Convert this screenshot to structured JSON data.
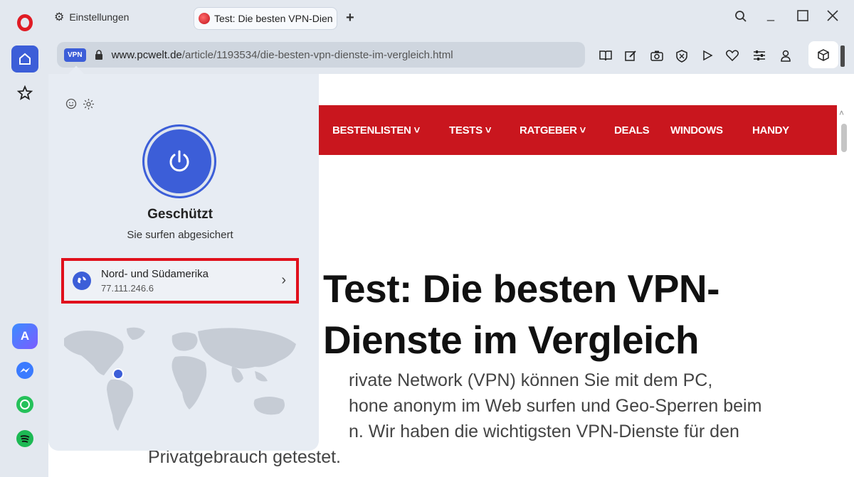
{
  "tabs": {
    "settings_label": "Einstellungen",
    "active_label": "Test: Die besten VPN-Dien"
  },
  "address": {
    "vpn_badge": "VPN",
    "url_domain": "www.pcwelt.de",
    "url_path": "/article/1193534/die-besten-vpn-dienste-im-vergleich.html"
  },
  "nav": {
    "items": [
      "BESTENLISTEN ˅",
      "TESTS ˅",
      "RATGEBER ˅",
      "DEALS",
      "WINDOWS",
      "HANDY"
    ]
  },
  "article": {
    "headline_line1": "Test: Die besten VPN-",
    "headline_line2": "Dienste im Vergleich",
    "lead_line1": "rivate Network (VPN) können Sie mit dem PC,",
    "lead_line2": "hone anonym im Web surfen und Geo-Sperren beim",
    "lead_line3": "n. Wir haben die wichtigsten VPN-Dienste für den",
    "lead_line4": "Privatgebrauch getestet."
  },
  "vpn": {
    "status_title": "Geschützt",
    "status_subtitle": "Sie surfen abgesichert",
    "location_region": "Nord- und Südamerika",
    "location_ip": "77.111.246.6"
  },
  "colors": {
    "accent": "#3c5ed8",
    "nav_red": "#c9161e",
    "highlight_border": "#e0101c"
  }
}
